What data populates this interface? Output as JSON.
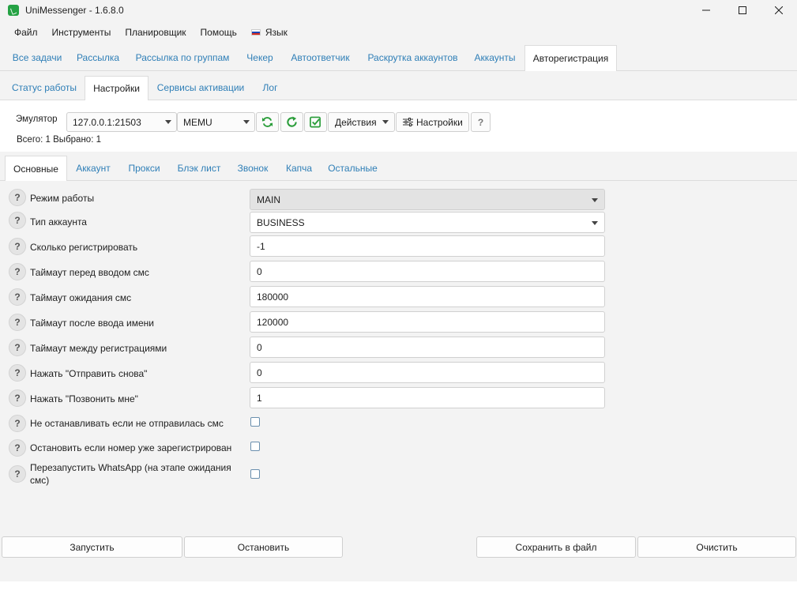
{
  "window": {
    "title": "UniMessenger - 1.6.8.0",
    "controls": [
      "minimize-icon",
      "maximize-icon",
      "close-icon"
    ]
  },
  "menu": {
    "items": [
      "Файл",
      "Инструменты",
      "Планировщик",
      "Помощь",
      "Язык"
    ],
    "language_flag": "russia-flag-icon"
  },
  "top_tabs": {
    "items": [
      "Все задачи",
      "Рассылка",
      "Рассылка по группам",
      "Чекер",
      "Автоответчик",
      "Раскрутка аккаунтов",
      "Аккаунты",
      "Авторегистрация"
    ],
    "active": "Авторегистрация"
  },
  "sub_tabs": {
    "items": [
      "Статус работы",
      "Настройки",
      "Сервисы активации",
      "Лог"
    ],
    "active": "Настройки"
  },
  "emulator": {
    "label": "Эмулятор",
    "address": "127.0.0.1:21503",
    "type": "MEMU",
    "actions_label": "Действия",
    "settings_label": "Настройки",
    "help_label": "?",
    "count_text": "Всего: 1 Выбрано: 1",
    "icons": [
      "refresh-all-icon",
      "refresh-icon",
      "select-check-icon",
      "sliders-icon"
    ],
    "accent_green": "#2a9d3a"
  },
  "settings_tabs": {
    "items": [
      "Основные",
      "Аккаунт",
      "Прокси",
      "Блэк лист",
      "Звонок",
      "Капча",
      "Остальные"
    ],
    "active": "Основные"
  },
  "form": {
    "help_glyph": "?",
    "rows": [
      {
        "label": "Режим работы",
        "kind": "select",
        "value": "MAIN",
        "disabled": true
      },
      {
        "label": "Тип аккаунта",
        "kind": "select",
        "value": "BUSINESS"
      },
      {
        "label": "Сколько регистрировать",
        "kind": "input",
        "value": "-1"
      },
      {
        "label": "Таймаут перед вводом смс",
        "kind": "input",
        "value": "0"
      },
      {
        "label": "Таймаут ожидания смс",
        "kind": "input",
        "value": "180000"
      },
      {
        "label": "Таймаут после ввода имени",
        "kind": "input",
        "value": "120000"
      },
      {
        "label": "Таймаут между регистрациями",
        "kind": "input",
        "value": "0"
      },
      {
        "label": "Нажать \"Отправить снова\"",
        "kind": "input",
        "value": "0"
      },
      {
        "label": "Нажать \"Позвонить мне\"",
        "kind": "input",
        "value": "1"
      },
      {
        "label": "Не останавливать если не отправилась смс",
        "kind": "checkbox",
        "checked": false
      },
      {
        "label": "Остановить если номер уже зарегистрирован",
        "kind": "checkbox",
        "checked": false
      },
      {
        "label": "Перезапустить WhatsApp (на этапе ожидания смс)",
        "kind": "checkbox",
        "checked": false
      }
    ]
  },
  "buttons": {
    "start": "Запустить",
    "stop": "Остановить",
    "save": "Сохранить в файл",
    "clear": "Очистить"
  }
}
